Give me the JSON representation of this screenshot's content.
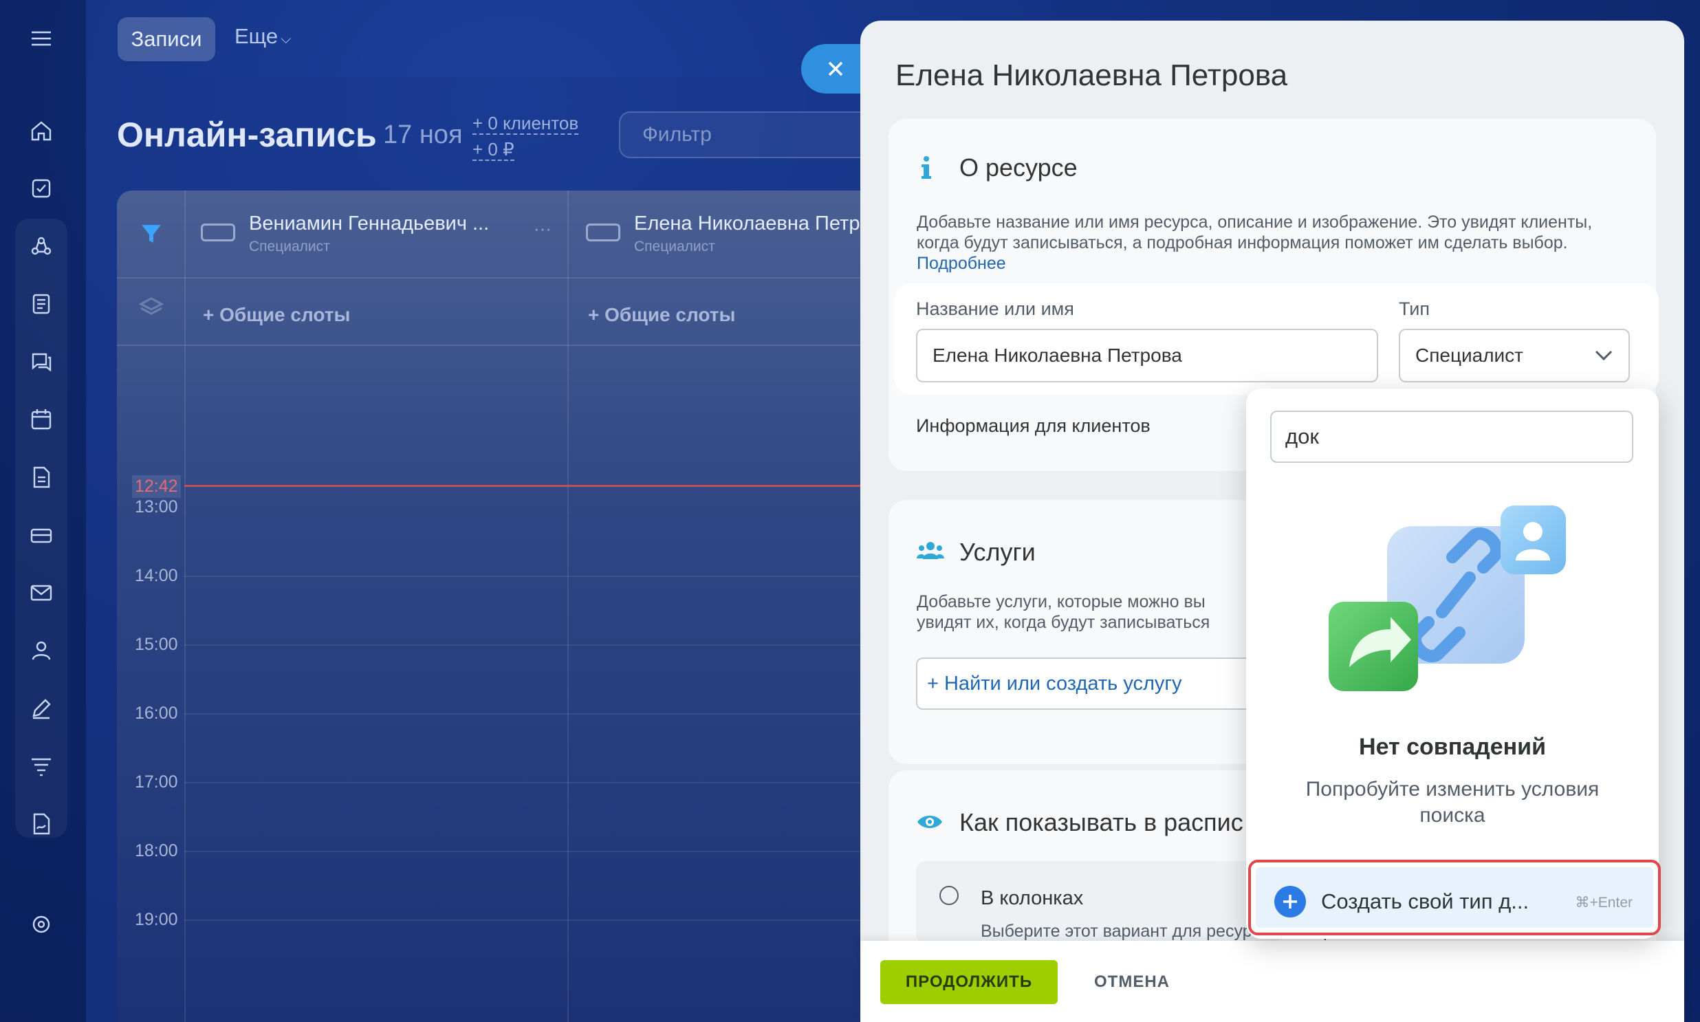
{
  "top_bar": {
    "tab_records": "Записи",
    "tab_more": "Еще"
  },
  "page": {
    "title": "Онлайн-запись",
    "date": "17 ноя",
    "stat_clients": "+ 0 клиентов",
    "stat_money": "+ 0 ₽",
    "filter_placeholder": "Фильтр"
  },
  "calendar": {
    "specialists": [
      {
        "name": "Вениамин Геннадьевич ...",
        "role": "Специалист",
        "slots": "+ Общие слоты"
      },
      {
        "name": "Елена Николаевна Петр",
        "role": "Специалист",
        "slots": "+ Общие слоты"
      }
    ],
    "now_time": "12:42",
    "hours": [
      "13:00",
      "14:00",
      "15:00",
      "16:00",
      "17:00",
      "18:00",
      "19:00"
    ]
  },
  "panel": {
    "title": "Елена Николаевна Петрова",
    "about": {
      "heading": "О ресурсе",
      "description": "Добавьте название или имя ресурса, описание и изображение. Это увидят клиенты, когда будут записываться, а подробная информация поможет им сделать выбор.",
      "link": "Подробнее",
      "name_label": "Название или имя",
      "name_value": "Елена Николаевна Петрова",
      "type_label": "Тип",
      "type_value": "Специалист",
      "info_label": "Информация для клиентов"
    },
    "services": {
      "heading": "Услуги",
      "description_line1": "Добавьте услуги, которые можно вы",
      "description_line2": "увидят их, когда будут записываться",
      "find_button": "+ Найти или создать услугу"
    },
    "display": {
      "heading": "Как показывать в распис",
      "option_label": "В колонках",
      "option_desc": "Выберите этот вариант для ресурсов, которые"
    },
    "footer": {
      "continue": "ПРОДОЛЖИТЬ",
      "cancel": "ОТМЕНА"
    }
  },
  "type_dropdown": {
    "search_value": "док",
    "empty_title": "Нет совпадений",
    "empty_hint": "Попробуйте изменить условия поиска",
    "create_label": "Создать свой тип д...",
    "create_hotkey": "⌘+Enter"
  },
  "colors": {
    "accent": "#2c7be5",
    "continue_button": "#9dcf00",
    "highlight_border": "#e0474c",
    "link": "#2067b0",
    "now_line": "#c44d59"
  }
}
